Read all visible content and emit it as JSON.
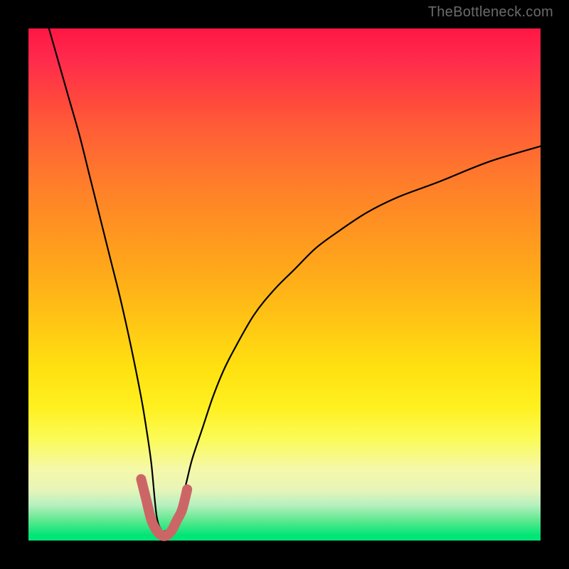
{
  "watermark": "TheBottleneck.com",
  "colors": {
    "background": "#000000",
    "gradient_top": "#ff1744",
    "gradient_mid": "#ffe010",
    "gradient_bottom": "#00e676",
    "curve": "#000000",
    "marker": "#cc6666"
  },
  "chart_data": {
    "type": "line",
    "title": "",
    "xlabel": "",
    "ylabel": "",
    "x_range": [
      0,
      100
    ],
    "y_range": [
      0,
      100
    ],
    "series": [
      {
        "name": "bottleneck-curve",
        "x": [
          4,
          6,
          8,
          10,
          12,
          14,
          16,
          18,
          20,
          22,
          23,
          24,
          25,
          26,
          27,
          28,
          29,
          30,
          31,
          32,
          34,
          36,
          38,
          40,
          44,
          48,
          52,
          56,
          60,
          66,
          72,
          80,
          90,
          100
        ],
        "y": [
          100,
          93,
          86,
          79,
          71,
          63,
          55,
          47,
          38,
          28,
          22,
          15,
          5,
          2,
          2,
          3,
          5,
          8,
          12,
          16,
          22,
          28,
          33,
          37,
          44,
          49,
          53,
          57,
          60,
          64,
          67,
          70,
          74,
          77
        ]
      },
      {
        "name": "optimal-marker",
        "x": [
          22,
          23,
          24,
          25,
          26,
          27,
          28,
          29,
          30,
          31
        ],
        "y": [
          12,
          8,
          4,
          2,
          1,
          1,
          2,
          4,
          6,
          10
        ]
      }
    ],
    "annotations": [
      {
        "text": "TheBottleneck.com",
        "position": "top-right"
      }
    ]
  }
}
